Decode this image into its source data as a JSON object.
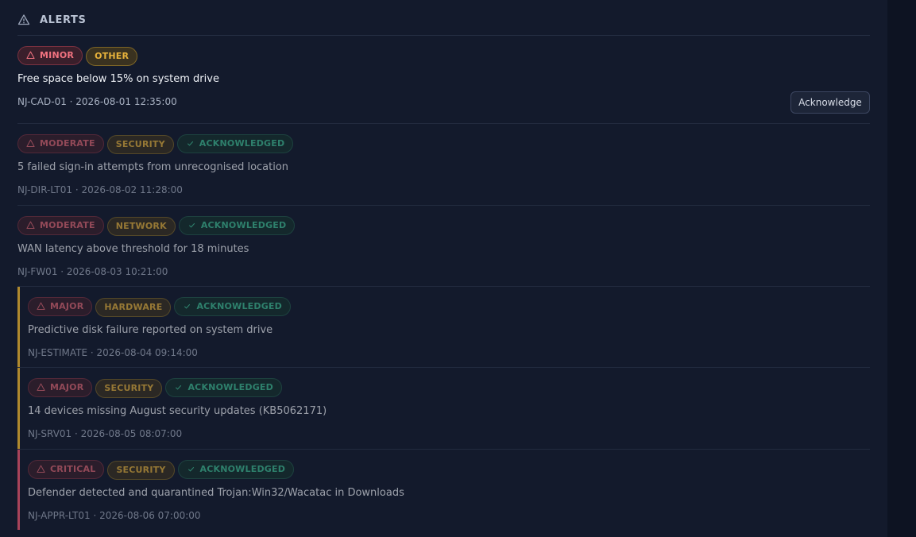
{
  "header": {
    "title": "ALERTS",
    "icon": "warning-triangle-icon"
  },
  "colors": {
    "background": "#131a2c",
    "severity": "#e06773",
    "category": "#e7b23b",
    "acknowledged": "#3fbf94",
    "bar_major": "#b08a2e",
    "bar_critical": "#a8435a"
  },
  "alerts": [
    {
      "severity": "MINOR",
      "category": "OTHER",
      "status": "",
      "message": "Free space below 15% on system drive",
      "meta": "NJ-CAD-01 · 2026-08-01 12:35:00",
      "action": "Acknowledge"
    },
    {
      "severity": "MODERATE",
      "category": "SECURITY",
      "status": "ACKNOWLEDGED",
      "message": "5 failed sign-in attempts from unrecognised location",
      "meta": "NJ-DIR-LT01 · 2026-08-02 11:28:00"
    },
    {
      "severity": "MODERATE",
      "category": "NETWORK",
      "status": "ACKNOWLEDGED",
      "message": "WAN latency above threshold for 18 minutes",
      "meta": "NJ-FW01 · 2026-08-03 10:21:00"
    },
    {
      "severity": "MAJOR",
      "category": "HARDWARE",
      "status": "ACKNOWLEDGED",
      "message": "Predictive disk failure reported on system drive",
      "meta": "NJ-ESTIMATE · 2026-08-04 09:14:00"
    },
    {
      "severity": "MAJOR",
      "category": "SECURITY",
      "status": "ACKNOWLEDGED",
      "message": "14 devices missing August security updates (KB5062171)",
      "meta": "NJ-SRV01 · 2026-08-05 08:07:00"
    },
    {
      "severity": "CRITICAL",
      "category": "SECURITY",
      "status": "ACKNOWLEDGED",
      "message": "Defender detected and quarantined Trojan:Win32/Wacatac in Downloads",
      "meta": "NJ-APPR-LT01 · 2026-08-06 07:00:00"
    }
  ]
}
